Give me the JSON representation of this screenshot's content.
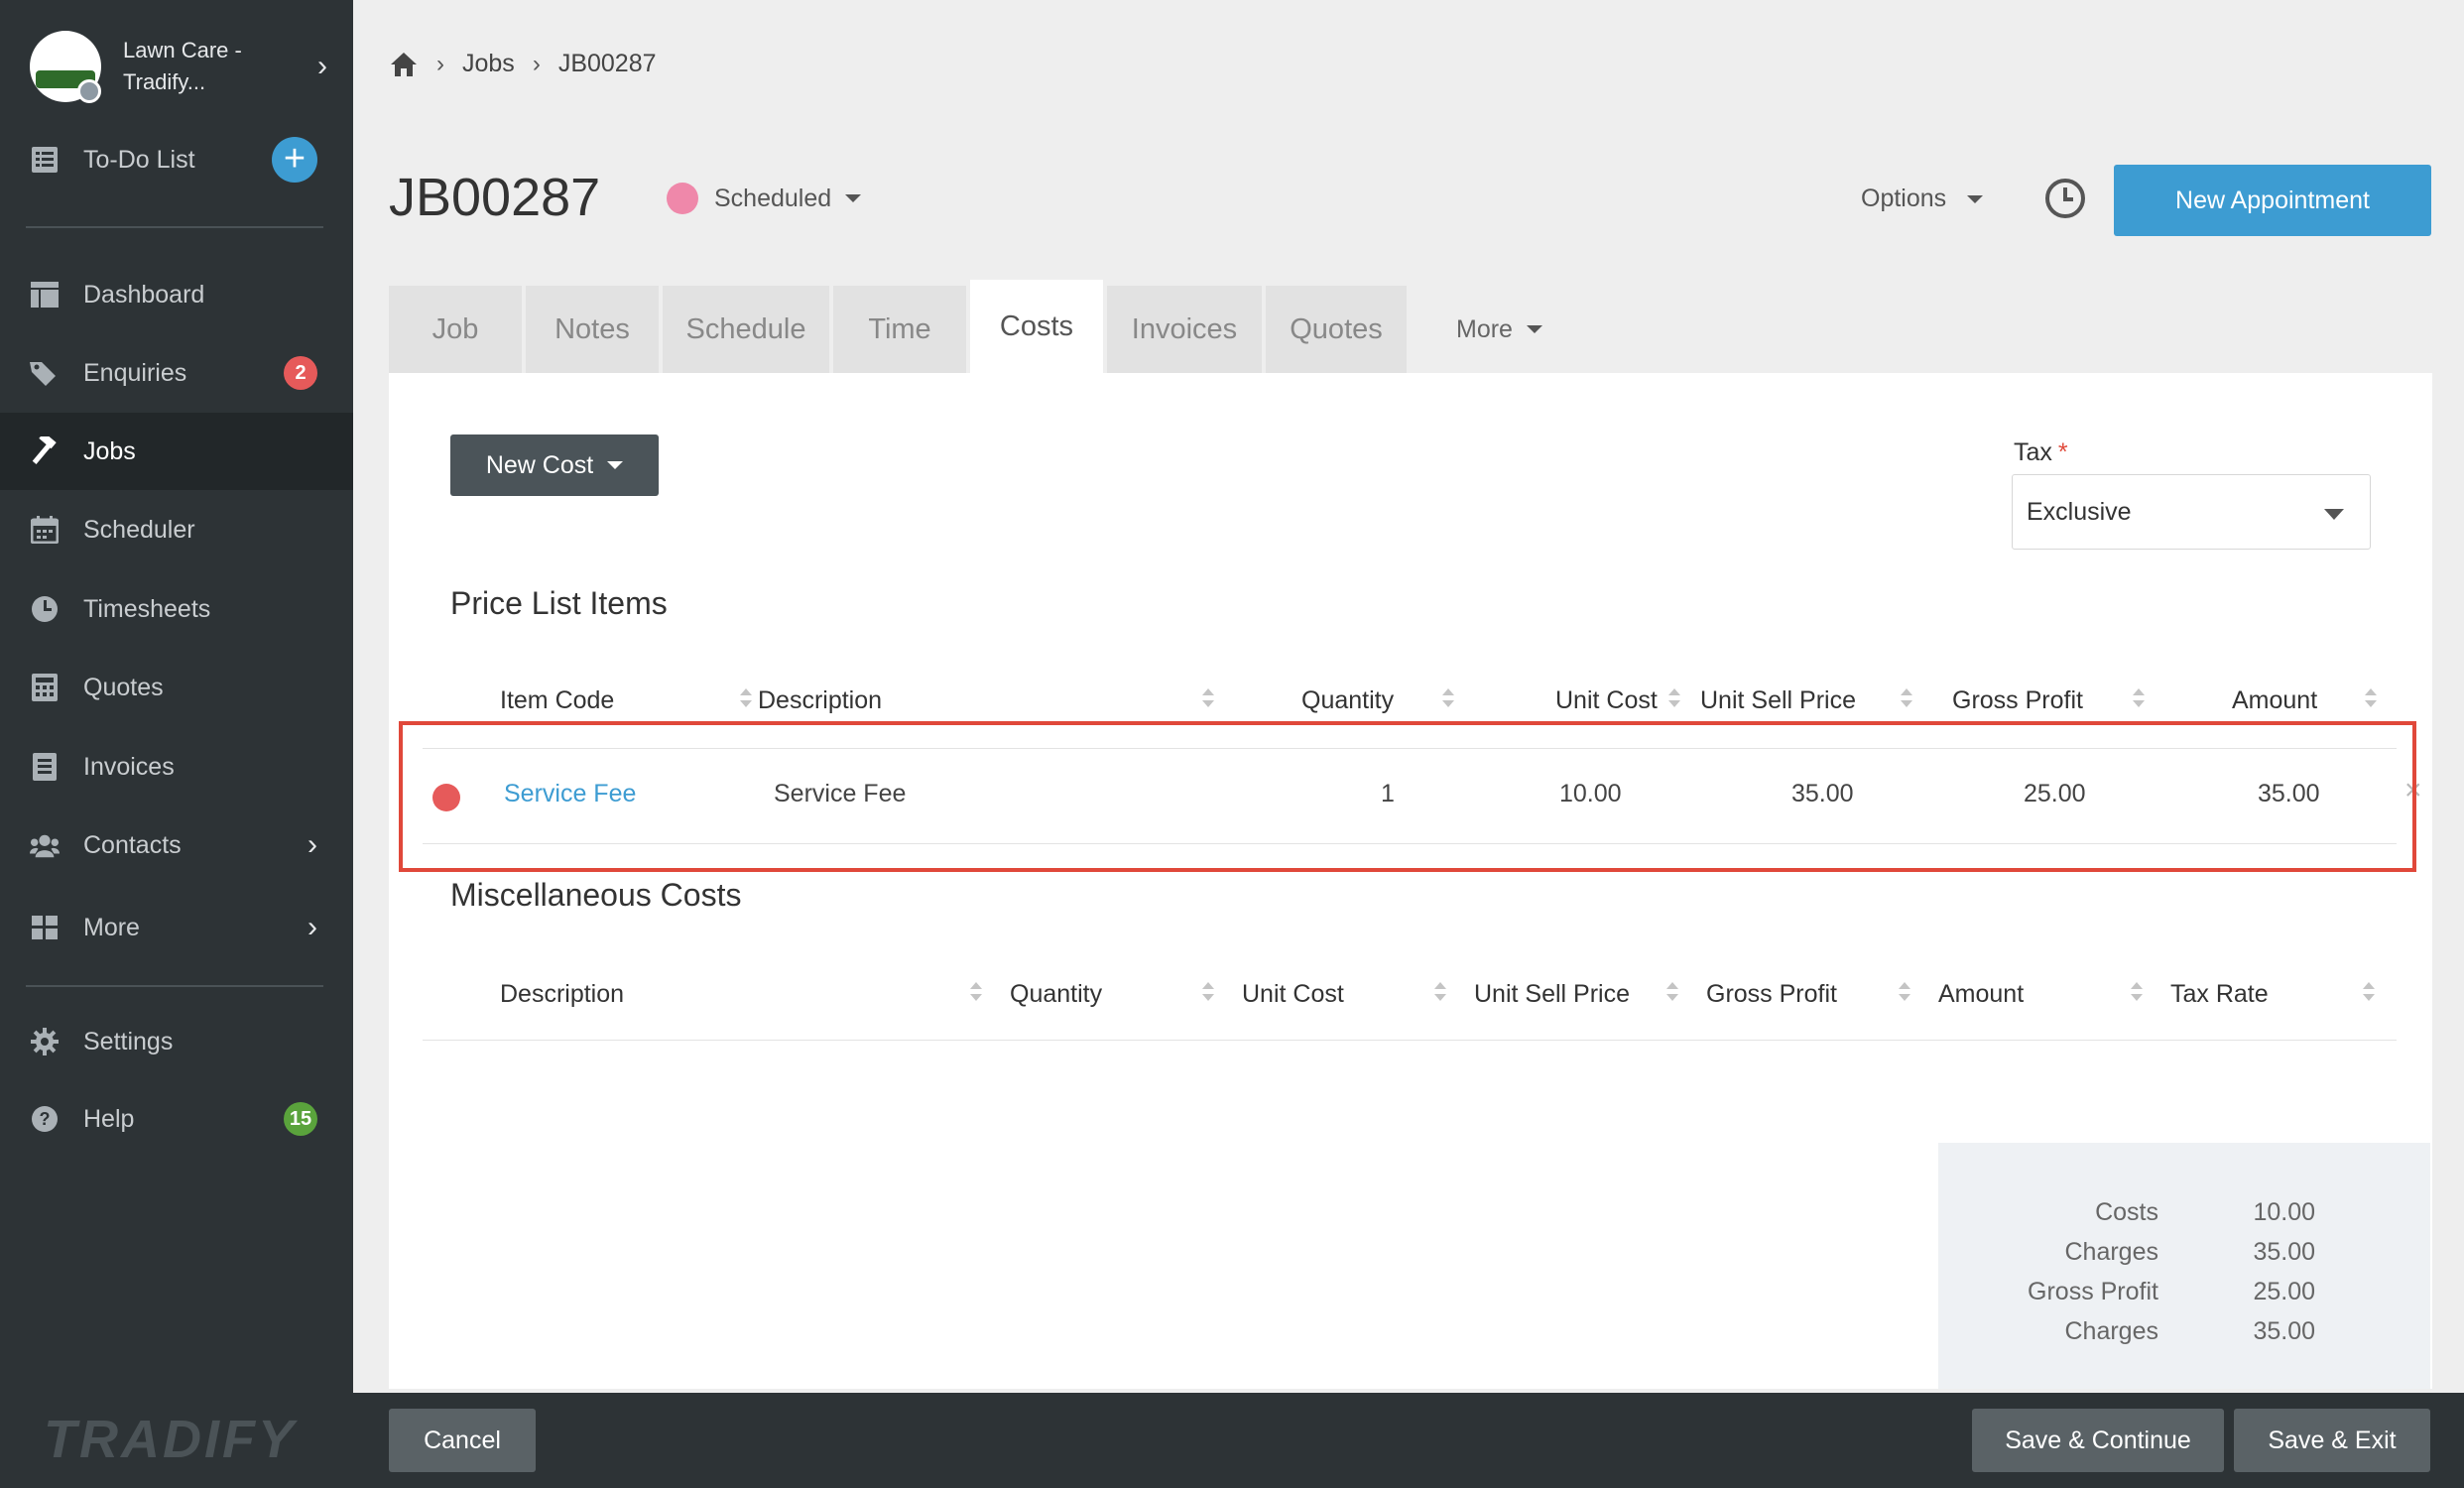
{
  "sidebar": {
    "org_name": "Lawn Care - Tradify...",
    "org_logo_text": "LAWN CARE",
    "todo_label": "To-Do List",
    "items": [
      {
        "label": "Dashboard",
        "icon": "dashboard-icon"
      },
      {
        "label": "Enquiries",
        "icon": "tags-icon",
        "badge": "2"
      },
      {
        "label": "Jobs",
        "icon": "hammer-icon",
        "active": true
      },
      {
        "label": "Scheduler",
        "icon": "calendar-icon"
      },
      {
        "label": "Timesheets",
        "icon": "clock-icon"
      },
      {
        "label": "Quotes",
        "icon": "calculator-icon"
      },
      {
        "label": "Invoices",
        "icon": "invoice-icon"
      },
      {
        "label": "Contacts",
        "icon": "users-icon"
      },
      {
        "label": "More",
        "icon": "grid-icon"
      },
      {
        "label": "Settings",
        "icon": "gear-icon"
      },
      {
        "label": "Help",
        "icon": "help-icon",
        "badge": "15"
      }
    ],
    "brand": "TRADIFY",
    "colors": {
      "enquiries_badge": "#e65a5a",
      "help_badge": "#5aa33c"
    }
  },
  "breadcrumb": {
    "jobs": "Jobs",
    "current": "JB00287"
  },
  "header": {
    "title": "JB00287",
    "status": "Scheduled",
    "status_color": "#ef88aa",
    "options": "Options",
    "new_appointment": "New Appointment"
  },
  "tabs": [
    "Job",
    "Notes",
    "Schedule",
    "Time",
    "Costs",
    "Invoices",
    "Quotes"
  ],
  "tabs_more": "More",
  "active_tab": "Costs",
  "costs": {
    "new_cost": "New Cost",
    "tax_label": "Tax",
    "tax_required": "*",
    "tax_value": "Exclusive",
    "price_list": {
      "title": "Price List Items",
      "columns": [
        "Item Code",
        "Description",
        "Quantity",
        "Unit Cost",
        "Unit Sell Price",
        "Gross Profit",
        "Amount"
      ],
      "rows": [
        {
          "item_code": "Service Fee",
          "description": "Service Fee",
          "quantity": "1",
          "unit_cost": "10.00",
          "unit_sell_price": "35.00",
          "gross_profit": "25.00",
          "amount": "35.00",
          "status_color": "#e65a5a"
        }
      ]
    },
    "misc": {
      "title": "Miscellaneous Costs",
      "columns": [
        "Description",
        "Quantity",
        "Unit Cost",
        "Unit Sell Price",
        "Gross Profit",
        "Amount",
        "Tax Rate"
      ]
    },
    "totals": [
      {
        "label": "Costs",
        "value": "10.00"
      },
      {
        "label": "Charges",
        "value": "35.00"
      },
      {
        "label": "Gross Profit",
        "value": "25.00"
      },
      {
        "label": "Charges",
        "value": "35.00"
      }
    ]
  },
  "footer": {
    "cancel": "Cancel",
    "save_continue": "Save & Continue",
    "save_exit": "Save & Exit"
  }
}
